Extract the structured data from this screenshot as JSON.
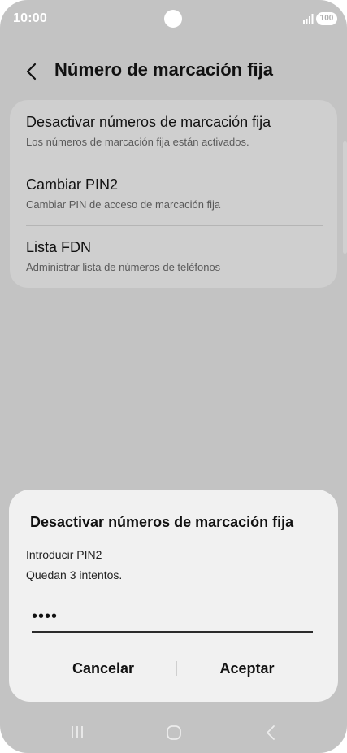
{
  "status_bar": {
    "time": "10:00",
    "battery": "100",
    "icons": [
      "signal-icon",
      "battery-icon",
      "camera-cutout"
    ]
  },
  "header": {
    "title": "Número de marcación fija",
    "back_icon": "chevron-left-icon"
  },
  "settings": {
    "items": [
      {
        "title": "Desactivar números de marcación fija",
        "subtitle": "Los números de marcación fija están activados."
      },
      {
        "title": "Cambiar PIN2",
        "subtitle": "Cambiar PIN de acceso de marcación fija"
      },
      {
        "title": "Lista FDN",
        "subtitle": "Administrar lista de números de teléfonos"
      }
    ]
  },
  "dialog": {
    "title": "Desactivar números de marcación fija",
    "line1": "Introducir PIN2",
    "line2": "Quedan 3 intentos.",
    "pin_value": "••••",
    "cancel_label": "Cancelar",
    "accept_label": "Aceptar"
  },
  "nav_bar": {
    "icons": [
      "recents-icon",
      "home-icon",
      "back-icon"
    ]
  },
  "colors": {
    "scrim_background": "#c3c3c3",
    "card_background": "#cfcfcf",
    "dialog_background": "#f1f1f1",
    "text_primary": "#111111",
    "text_secondary": "#5a5a5a"
  }
}
